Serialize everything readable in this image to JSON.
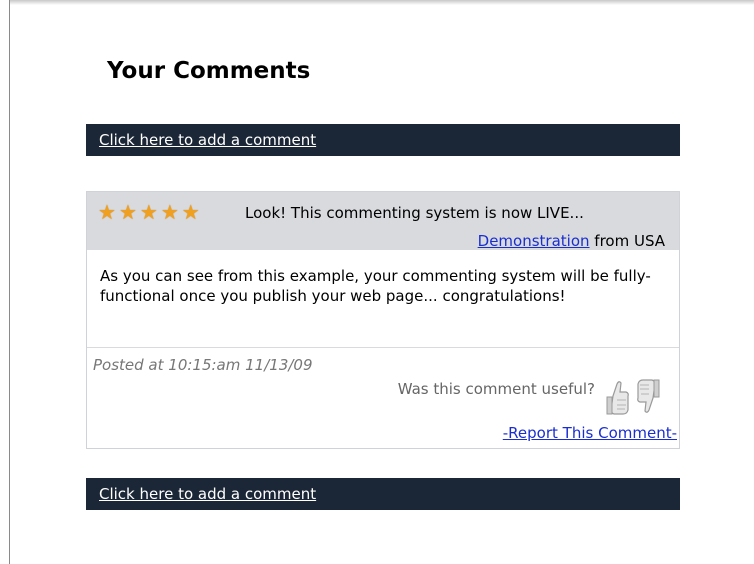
{
  "page": {
    "title": "Your Comments",
    "add_comment_link_top": "Click here to add a comment",
    "add_comment_link_bottom": "Click here to add a comment"
  },
  "comment": {
    "rating": 5,
    "rating_max": 5,
    "star_color": "#f0a020",
    "headline": "Look! This commenting system is now LIVE...",
    "author_name": "Demonstration",
    "author_location": " from USA",
    "body": "As you can see from this example, your commenting system will be fully-functional once you publish your web page... congratulations!",
    "posted": "Posted at 10:15:am 11/13/09",
    "useful_prompt": "Was this comment useful?",
    "report_link": "-Report This Comment-",
    "icons": {
      "vote_up": "thumbs-up-icon",
      "vote_down": "thumbs-down-icon"
    }
  },
  "colors": {
    "bar_background": "#1b2636",
    "header_background": "#d8dade",
    "link_color": "#1a2ed0"
  }
}
